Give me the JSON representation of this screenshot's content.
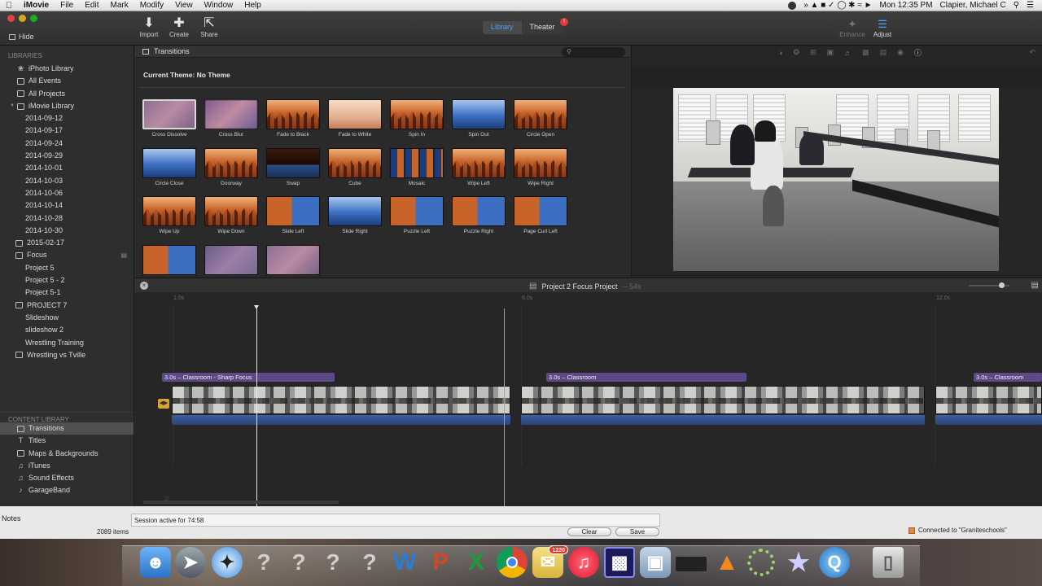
{
  "menubar": {
    "app": "iMovie",
    "menus": [
      "File",
      "Edit",
      "Mark",
      "Modify",
      "View",
      "Window",
      "Help"
    ],
    "clock": "Mon 12:35 PM",
    "user": "Clapier, Michael C"
  },
  "toolbar": {
    "hide_label": "Hide",
    "import_label": "Import",
    "create_label": "Create",
    "share_label": "Share",
    "library_tab": "Library",
    "theater_tab": "Theater",
    "theater_badge": "!",
    "enhance_label": "Enhance",
    "adjust_label": "Adjust"
  },
  "sidebar": {
    "libraries_heading": "LIBRARIES",
    "libraries": [
      {
        "label": "iPhoto Library"
      },
      {
        "label": "All Events"
      },
      {
        "label": "All Projects"
      },
      {
        "label": "iMovie Library"
      },
      {
        "label": "2014-09-12"
      },
      {
        "label": "2014-09-17"
      },
      {
        "label": "2014-09-24"
      },
      {
        "label": "2014-09-29"
      },
      {
        "label": "2014-10-01"
      },
      {
        "label": "2014-10-03"
      },
      {
        "label": "2014-10-06"
      },
      {
        "label": "2014-10-14"
      },
      {
        "label": "2014-10-28"
      },
      {
        "label": "2014-10-30"
      },
      {
        "label": "2015-02-17"
      },
      {
        "label": "Focus"
      },
      {
        "label": "Project 5"
      },
      {
        "label": "Project 5 - 2"
      },
      {
        "label": "Project 5-1"
      },
      {
        "label": "PROJECT 7"
      },
      {
        "label": "Slideshow"
      },
      {
        "label": "slideshow 2"
      },
      {
        "label": "Wrestling Training"
      },
      {
        "label": "Wrestling vs Tville"
      }
    ],
    "content_heading": "CONTENT LIBRARY",
    "content": [
      {
        "label": "Transitions"
      },
      {
        "label": "Titles"
      },
      {
        "label": "Maps & Backgrounds"
      },
      {
        "label": "iTunes"
      },
      {
        "label": "Sound Effects"
      },
      {
        "label": "GarageBand"
      }
    ]
  },
  "browser": {
    "title": "Transitions",
    "search_placeholder": "",
    "theme_label": "Current Theme: No Theme",
    "transitions": [
      {
        "label": "Cross Dissolve",
        "style": "dissolve"
      },
      {
        "label": "Cross Blur",
        "style": "blur"
      },
      {
        "label": "Fade to Black",
        "style": "forest"
      },
      {
        "label": "Fade to White",
        "style": "pale"
      },
      {
        "label": "Spin In",
        "style": "forest"
      },
      {
        "label": "Spin Out",
        "style": "blue"
      },
      {
        "label": "Circle Open",
        "style": "forest"
      },
      {
        "label": "Circle Close",
        "style": "blue"
      },
      {
        "label": "Doorway",
        "style": "forest"
      },
      {
        "label": "Swap",
        "style": "black"
      },
      {
        "label": "Cube",
        "style": "forest"
      },
      {
        "label": "Mosaic",
        "style": "mosaic"
      },
      {
        "label": "Wipe Left",
        "style": "forest"
      },
      {
        "label": "Wipe Right",
        "style": "forest"
      },
      {
        "label": "Wipe Up",
        "style": "forest"
      },
      {
        "label": "Wipe Down",
        "style": "forest"
      },
      {
        "label": "Slide Left",
        "style": "mix"
      },
      {
        "label": "Slide Right",
        "style": "blue"
      },
      {
        "label": "Puzzle Left",
        "style": "mix"
      },
      {
        "label": "Puzzle Right",
        "style": "mix"
      },
      {
        "label": "Page Curl Left",
        "style": "mix"
      },
      {
        "label": "",
        "style": "mix"
      },
      {
        "label": "",
        "style": "purple"
      },
      {
        "label": "",
        "style": "dissolve"
      }
    ]
  },
  "timeline": {
    "title": "Project 2 Focus Project",
    "duration": "-- 54s",
    "ruler": [
      "1.0s",
      "6.0s",
      "12.0s"
    ],
    "clips": [
      {
        "label": "3.0s – Classroom - Sharp Focus"
      },
      {
        "label": "3.0s – Classroom"
      },
      {
        "label": "3.0s – Classroom"
      }
    ]
  },
  "background_window": {
    "notes_label": "Notes",
    "count_label": "2089 items",
    "session_text": "Session active for 74:58",
    "clear_label": "Clear",
    "save_label": "Save",
    "connection_text": "Connected to \"Graniteschools\""
  },
  "dock": {
    "mail_badge": "1220"
  },
  "colors": {
    "accent": "#4aa3ff",
    "clip_label": "#5c4a86",
    "skimmer": "#f08a4b",
    "audio": "#3e5e9e"
  }
}
